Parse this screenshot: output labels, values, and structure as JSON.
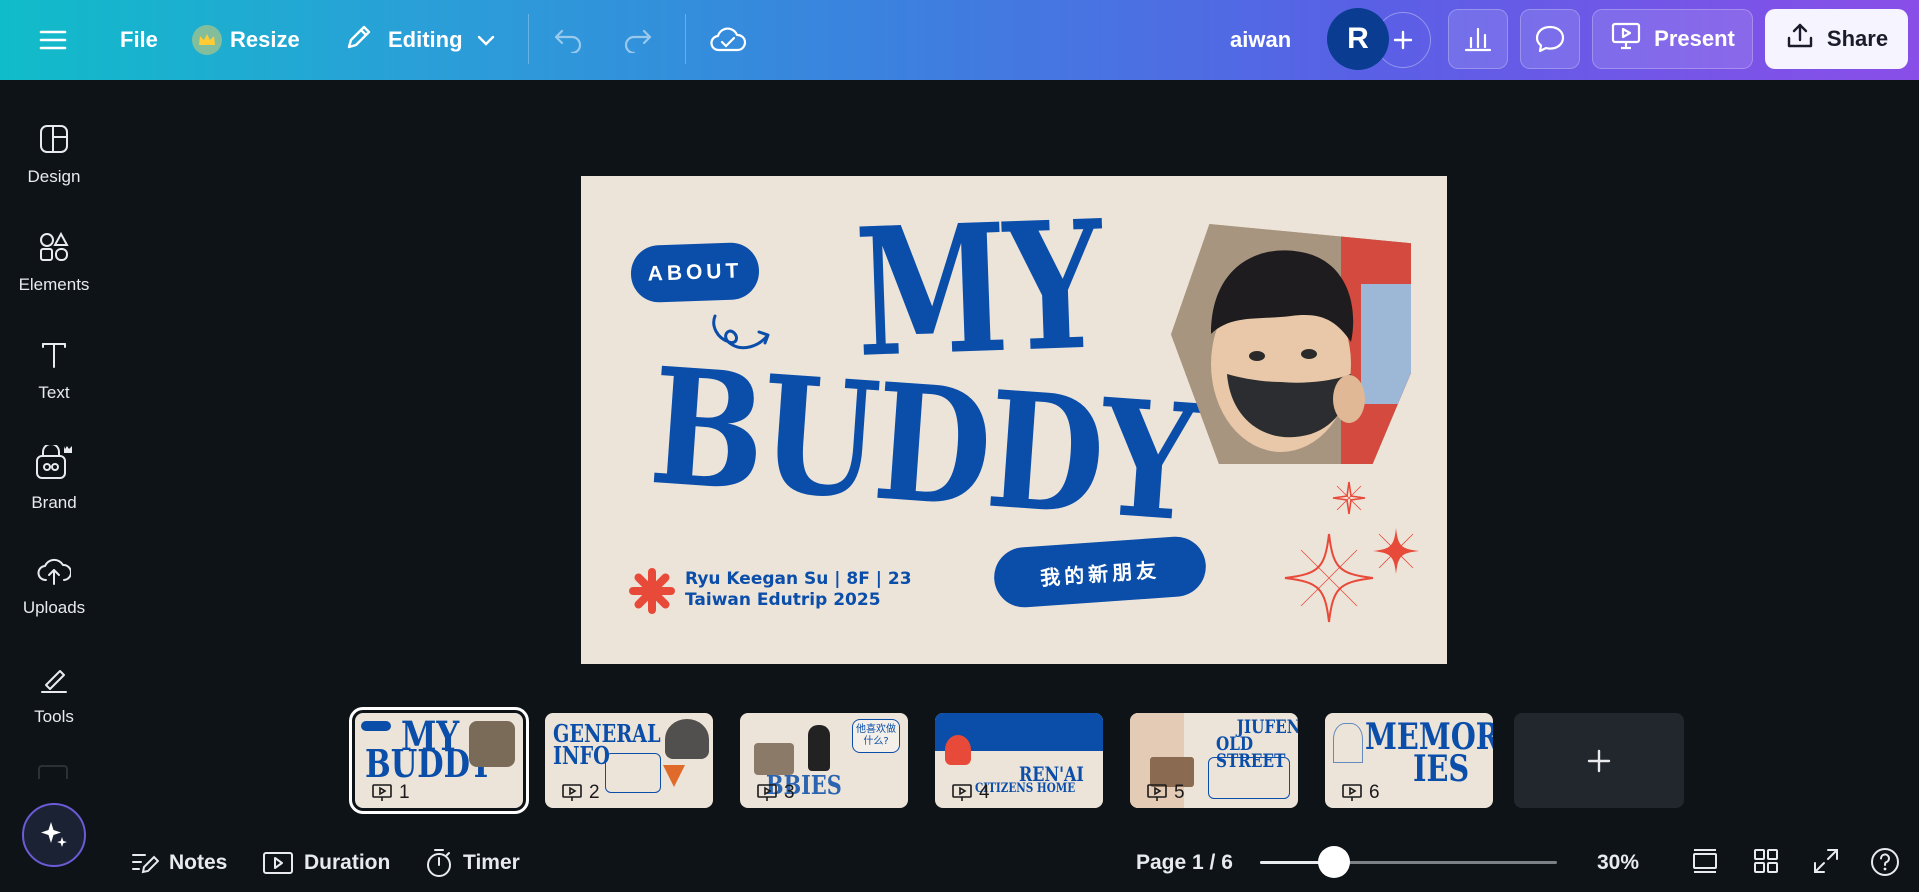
{
  "topbar": {
    "file_label": "File",
    "resize_label": "Resize",
    "editing_label": "Editing",
    "user_name": "aiwan",
    "avatar_initial": "R",
    "present_label": "Present",
    "share_label": "Share"
  },
  "sidebar": {
    "items": [
      {
        "label": "Design",
        "icon": "design-icon"
      },
      {
        "label": "Elements",
        "icon": "elements-icon"
      },
      {
        "label": "Text",
        "icon": "text-icon"
      },
      {
        "label": "Brand",
        "icon": "brand-icon"
      },
      {
        "label": "Uploads",
        "icon": "uploads-icon"
      },
      {
        "label": "Tools",
        "icon": "tools-icon"
      }
    ]
  },
  "slide": {
    "about_label": "ABOUT",
    "title_line1": "MY",
    "title_line2": "BUDDY",
    "chinese_subtitle": "我的新朋友",
    "byline_line1": "Ryu Keegan Su | 8F | 23",
    "byline_line2": "Taiwan Edutrip 2025",
    "accent_color": "#0a4eaa",
    "background_color": "#ede4d9",
    "sparkle_color": "#e84a3a"
  },
  "filmstrip": {
    "pages": [
      {
        "number": "1",
        "title": "MY BUDDY",
        "active": true
      },
      {
        "number": "2",
        "title": "GENERAL INFO",
        "active": false
      },
      {
        "number": "3",
        "title": "HOBBIES",
        "active": false
      },
      {
        "number": "4",
        "title": "REN'AI CITIZENS HOME",
        "active": false
      },
      {
        "number": "5",
        "title": "JIUFEN OLD STREET",
        "active": false
      },
      {
        "number": "6",
        "title": "MEMORIES",
        "active": false
      }
    ],
    "thumb2_line1": "GENERAL",
    "thumb2_line2": "INFO",
    "thumb3_title": "BBIES",
    "thumb3_bubble": "他喜欢做什么?",
    "thumb4_title": "REN'AI",
    "thumb4_subtitle": "CITIZENS HOME",
    "thumb5_line1": "JIUFEN",
    "thumb5_line2": "OLD STREET",
    "thumb6_line1": "MEMOR",
    "thumb6_line2": "IES"
  },
  "bottombar": {
    "notes_label": "Notes",
    "duration_label": "Duration",
    "timer_label": "Timer",
    "page_indicator": "Page 1 / 6",
    "zoom_label": "30%",
    "zoom_fraction": 0.25
  }
}
